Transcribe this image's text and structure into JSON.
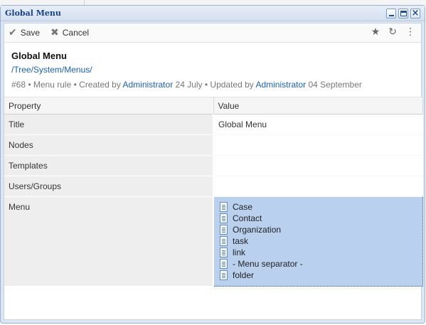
{
  "window": {
    "title": "Global Menu"
  },
  "toolbar": {
    "save_label": "Save",
    "cancel_label": "Cancel"
  },
  "header": {
    "title": "Global Menu",
    "path": "/Tree/System/Menus/",
    "meta": {
      "prefix": "#68 • Menu rule • Created by ",
      "created_by": "Administrator",
      "created_mid": " 24 July • Updated by ",
      "updated_by": "Administrator",
      "updated_date": " 04 September"
    }
  },
  "table": {
    "headers": [
      "Property",
      "Value"
    ],
    "rows": [
      {
        "property": "Title",
        "value": "Global Menu"
      },
      {
        "property": "Nodes",
        "value": ""
      },
      {
        "property": "Templates",
        "value": ""
      },
      {
        "property": "Users/Groups",
        "value": ""
      },
      {
        "property": "Menu"
      }
    ],
    "menu_items": [
      "Case",
      "Contact",
      "Organization",
      "task",
      "link",
      "- Menu separator -",
      "folder"
    ]
  },
  "icons": {
    "save": "check-icon",
    "cancel": "x-icon",
    "star": "star-icon",
    "refresh": "refresh-icon",
    "more": "vertical-dots-icon",
    "menu_item": "document-icon"
  },
  "colors": {
    "title": "#15428b",
    "link": "#1a5fb4",
    "selection": "#b9d0ee"
  }
}
